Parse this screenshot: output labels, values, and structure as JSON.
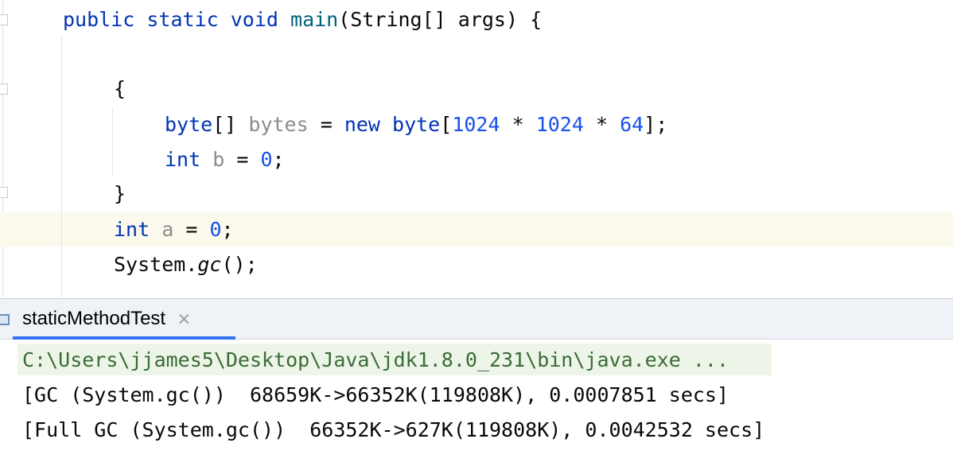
{
  "editor": {
    "lines": [
      {
        "keyword1": "public",
        "keyword2": "static",
        "keyword3": "void",
        "method": "main",
        "params": "(String[] args) {"
      },
      {
        "brace": "{"
      },
      {
        "type": "byte",
        "arr": "[]",
        "var": "bytes",
        "eq": " = ",
        "kw_new": "new",
        "type2": "byte",
        "open": "[",
        "n1": "1024",
        "op1": " * ",
        "n2": "1024",
        "op2": " * ",
        "n3": "64",
        "close": "];"
      },
      {
        "type": "int",
        "var": "b",
        "eq": " = ",
        "val": "0",
        "end": ";"
      },
      {
        "brace": "}"
      },
      {
        "type": "int",
        "var": "a",
        "eq": " = ",
        "val": "0",
        "end": ";"
      },
      {
        "obj": "System.",
        "method": "gc",
        "end": "();"
      }
    ]
  },
  "run_panel": {
    "tab_label": "staticMethodTest",
    "close_glyph": "×",
    "icon": "run-console-icon"
  },
  "console": {
    "command": "C:\\Users\\jjames5\\Desktop\\Java\\jdk1.8.0_231\\bin\\java.exe ...",
    "output": [
      "[GC (System.gc())  68659K->66352K(119808K), 0.0007851 secs]",
      "[Full GC (System.gc())  66352K->627K(119808K), 0.0042532 secs]"
    ]
  }
}
